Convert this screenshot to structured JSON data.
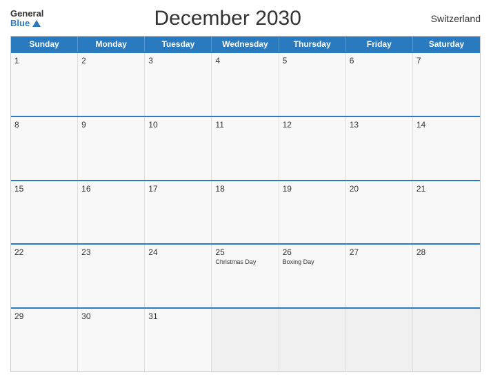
{
  "header": {
    "title": "December 2030",
    "country": "Switzerland",
    "logo_general": "General",
    "logo_blue": "Blue"
  },
  "days_of_week": [
    {
      "label": "Sunday"
    },
    {
      "label": "Monday"
    },
    {
      "label": "Tuesday"
    },
    {
      "label": "Wednesday"
    },
    {
      "label": "Thursday"
    },
    {
      "label": "Friday"
    },
    {
      "label": "Saturday"
    }
  ],
  "weeks": [
    {
      "days": [
        {
          "number": "1",
          "holiday": ""
        },
        {
          "number": "2",
          "holiday": ""
        },
        {
          "number": "3",
          "holiday": ""
        },
        {
          "number": "4",
          "holiday": ""
        },
        {
          "number": "5",
          "holiday": ""
        },
        {
          "number": "6",
          "holiday": ""
        },
        {
          "number": "7",
          "holiday": ""
        }
      ]
    },
    {
      "days": [
        {
          "number": "8",
          "holiday": ""
        },
        {
          "number": "9",
          "holiday": ""
        },
        {
          "number": "10",
          "holiday": ""
        },
        {
          "number": "11",
          "holiday": ""
        },
        {
          "number": "12",
          "holiday": ""
        },
        {
          "number": "13",
          "holiday": ""
        },
        {
          "number": "14",
          "holiday": ""
        }
      ]
    },
    {
      "days": [
        {
          "number": "15",
          "holiday": ""
        },
        {
          "number": "16",
          "holiday": ""
        },
        {
          "number": "17",
          "holiday": ""
        },
        {
          "number": "18",
          "holiday": ""
        },
        {
          "number": "19",
          "holiday": ""
        },
        {
          "number": "20",
          "holiday": ""
        },
        {
          "number": "21",
          "holiday": ""
        }
      ]
    },
    {
      "days": [
        {
          "number": "22",
          "holiday": ""
        },
        {
          "number": "23",
          "holiday": ""
        },
        {
          "number": "24",
          "holiday": ""
        },
        {
          "number": "25",
          "holiday": "Christmas Day"
        },
        {
          "number": "26",
          "holiday": "Boxing Day"
        },
        {
          "number": "27",
          "holiday": ""
        },
        {
          "number": "28",
          "holiday": ""
        }
      ]
    },
    {
      "days": [
        {
          "number": "29",
          "holiday": ""
        },
        {
          "number": "30",
          "holiday": ""
        },
        {
          "number": "31",
          "holiday": ""
        },
        {
          "number": "",
          "holiday": ""
        },
        {
          "number": "",
          "holiday": ""
        },
        {
          "number": "",
          "holiday": ""
        },
        {
          "number": "",
          "holiday": ""
        }
      ]
    }
  ]
}
